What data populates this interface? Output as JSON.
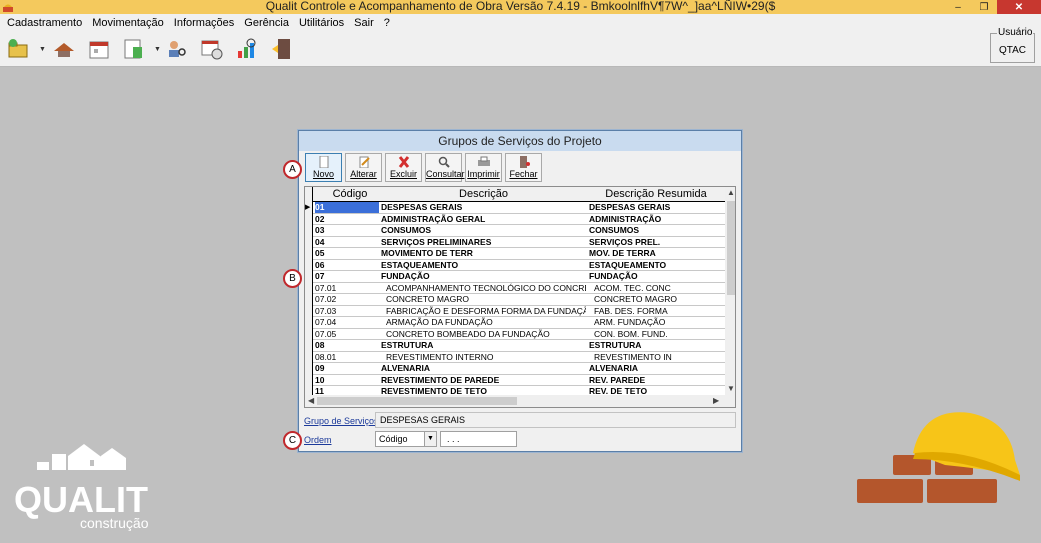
{
  "window": {
    "title": "Qualit Controle e Acompanhamento de Obra Versão 7.4.19 - BmkoolnlfhV¶7W^_]aa^LÑIW•29($",
    "minimize": "‒",
    "restore": "❐",
    "close": "✕"
  },
  "menu": [
    "Cadastramento",
    "Movimentação",
    "Informações",
    "Gerência",
    "Utilitários",
    "Sair",
    "?"
  ],
  "user": {
    "label": "Usuário",
    "value": "QTAC"
  },
  "dialog": {
    "title": "Grupos de Serviços do Projeto",
    "buttons": [
      "Novo",
      "Alterar",
      "Excluir",
      "Consultar",
      "Imprimir",
      "Fechar"
    ],
    "markers": [
      "A",
      "B",
      "C"
    ],
    "columns": [
      "Código",
      "Descrição",
      "Descrição Resumida"
    ],
    "rows": [
      {
        "code": "01",
        "desc": "DESPESAS GERAIS",
        "short": "DESPESAS GERAIS",
        "bold": true
      },
      {
        "code": "02",
        "desc": "ADMINISTRAÇÃO GERAL",
        "short": "ADMINISTRAÇÃO",
        "bold": true
      },
      {
        "code": "03",
        "desc": "CONSUMOS",
        "short": "CONSUMOS",
        "bold": true
      },
      {
        "code": "04",
        "desc": "SERVIÇOS PRELIMINARES",
        "short": "SERVIÇOS PREL.",
        "bold": true
      },
      {
        "code": "05",
        "desc": "MOVIMENTO DE TERR",
        "short": "MOV. DE TERRA",
        "bold": true
      },
      {
        "code": "06",
        "desc": "ESTAQUEAMENTO",
        "short": "ESTAQUEAMENTO",
        "bold": true
      },
      {
        "code": "07",
        "desc": "FUNDAÇÃO",
        "short": "FUNDAÇÃO",
        "bold": true
      },
      {
        "code": "07.01",
        "desc": "ACOMPANHAMENTO TECNOLÓGICO DO CONCRETO",
        "short": "ACOM. TEC. CONC",
        "bold": false
      },
      {
        "code": "07.02",
        "desc": "CONCRETO MAGRO",
        "short": "CONCRETO MAGRO",
        "bold": false
      },
      {
        "code": "07.03",
        "desc": "FABRICAÇÃO E DESFORMA FORMA DA FUNDAÇÃO",
        "short": "FAB. DES. FORMA",
        "bold": false
      },
      {
        "code": "07.04",
        "desc": "ARMAÇÃO DA FUNDAÇÃO",
        "short": "ARM. FUNDAÇÃO",
        "bold": false
      },
      {
        "code": "07.05",
        "desc": "CONCRETO BOMBEADO DA FUNDAÇÃO",
        "short": "CON. BOM. FUND.",
        "bold": false
      },
      {
        "code": "08",
        "desc": "ESTRUTURA",
        "short": "ESTRUTURA",
        "bold": true
      },
      {
        "code": "08.01",
        "desc": "REVESTIMENTO INTERNO",
        "short": "REVESTIMENTO IN",
        "bold": false
      },
      {
        "code": "09",
        "desc": "ALVENARIA",
        "short": "ALVENARIA",
        "bold": true
      },
      {
        "code": "10",
        "desc": "REVESTIMENTO DE PAREDE",
        "short": "REV. PAREDE",
        "bold": true
      },
      {
        "code": "11",
        "desc": "REVESTIMENTO DE TETO",
        "short": "REV. DE TETO",
        "bold": true
      }
    ],
    "group_label": "Grupo de Serviços",
    "group_value": "DESPESAS GERAIS",
    "order_label": "Ordem",
    "order_value": "Código",
    "order_input": ". . ."
  },
  "logo": {
    "brand": "QUALIT",
    "tagline": "construção"
  },
  "colors": {
    "titlebar": "#f4c95d",
    "close": "#c7372f",
    "selection": "#3b6fd9",
    "marker": "#c0282c"
  }
}
